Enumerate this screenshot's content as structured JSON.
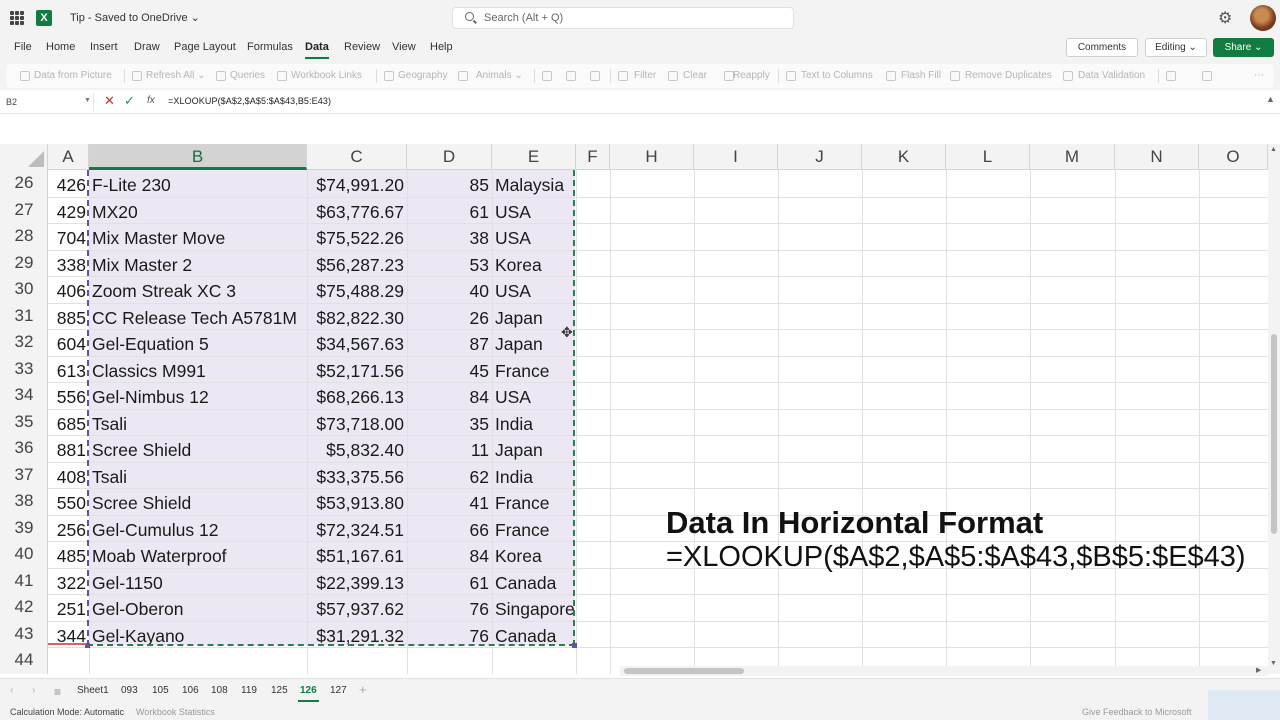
{
  "titlebar": {
    "app_icon": "excel-logo",
    "doc_name": "Tip - Saved to OneDrive ⌄",
    "search_placeholder": "Search (Alt + Q)",
    "settings_icon": "gear-icon"
  },
  "menu": {
    "items": [
      "File",
      "Home",
      "Insert",
      "Draw",
      "Page Layout",
      "Formulas",
      "Data",
      "Review",
      "View",
      "Help"
    ],
    "active": "Data",
    "comments": "Comments",
    "editing": "Editing ⌄",
    "share": "Share ⌄"
  },
  "ribbon": {
    "items": [
      "Data from Picture",
      "Refresh All ⌄",
      "Queries",
      "Workbook Links",
      "Geography",
      "Animals ⌄",
      "Filter",
      "Clear",
      "Reapply",
      "Text to Columns",
      "Flash Fill",
      "Remove Duplicates",
      "Data Validation"
    ]
  },
  "formula_bar": {
    "name_box": "B2",
    "formula": "=XLOOKUP($A$2,$A$5:$A$43,B5:E43)"
  },
  "columns": [
    "A",
    "B",
    "C",
    "D",
    "E",
    "F",
    "H",
    "I",
    "J",
    "K",
    "L",
    "M",
    "N",
    "O"
  ],
  "selected_column": "B",
  "rows": [
    {
      "row": "26",
      "a": "426",
      "b": "F-Lite 230",
      "c": "$74,991.20",
      "d": "85",
      "e": "Malaysia"
    },
    {
      "row": "27",
      "a": "429",
      "b": "MX20",
      "c": "$63,776.67",
      "d": "61",
      "e": "USA"
    },
    {
      "row": "28",
      "a": "704",
      "b": "Mix Master Move",
      "c": "$75,522.26",
      "d": "38",
      "e": "USA"
    },
    {
      "row": "29",
      "a": "338",
      "b": "Mix Master 2",
      "c": "$56,287.23",
      "d": "53",
      "e": "Korea"
    },
    {
      "row": "30",
      "a": "406",
      "b": "Zoom Streak XC 3",
      "c": "$75,488.29",
      "d": "40",
      "e": "USA"
    },
    {
      "row": "31",
      "a": "885",
      "b": "CC Release Tech A5781M",
      "c": "$82,822.30",
      "d": "26",
      "e": "Japan"
    },
    {
      "row": "32",
      "a": "604",
      "b": "Gel-Equation 5",
      "c": "$34,567.63",
      "d": "87",
      "e": "Japan"
    },
    {
      "row": "33",
      "a": "613",
      "b": "Classics M991",
      "c": "$52,171.56",
      "d": "45",
      "e": "France"
    },
    {
      "row": "34",
      "a": "556",
      "b": "Gel-Nimbus 12",
      "c": "$68,266.13",
      "d": "84",
      "e": "USA"
    },
    {
      "row": "35",
      "a": "685",
      "b": "Tsali",
      "c": "$73,718.00",
      "d": "35",
      "e": "India"
    },
    {
      "row": "36",
      "a": "881",
      "b": "Scree Shield",
      "c": "$5,832.40",
      "d": "11",
      "e": "Japan"
    },
    {
      "row": "37",
      "a": "408",
      "b": "Tsali",
      "c": "$33,375.56",
      "d": "62",
      "e": "India"
    },
    {
      "row": "38",
      "a": "550",
      "b": "Scree Shield",
      "c": "$53,913.80",
      "d": "41",
      "e": "France"
    },
    {
      "row": "39",
      "a": "256",
      "b": "Gel-Cumulus 12",
      "c": "$72,324.51",
      "d": "66",
      "e": "France"
    },
    {
      "row": "40",
      "a": "485",
      "b": "Moab Waterproof",
      "c": "$51,167.61",
      "d": "84",
      "e": "Korea"
    },
    {
      "row": "41",
      "a": "322",
      "b": "Gel-1150",
      "c": "$22,399.13",
      "d": "61",
      "e": "Canada"
    },
    {
      "row": "42",
      "a": "251",
      "b": "Gel-Oberon",
      "c": "$57,937.62",
      "d": "76",
      "e": "Singapore"
    },
    {
      "row": "43",
      "a": "344",
      "b": "Gel-Kayano",
      "c": "$31,291.32",
      "d": "76",
      "e": "Canada"
    },
    {
      "row": "44",
      "a": "",
      "b": "",
      "c": "",
      "d": "",
      "e": ""
    }
  ],
  "caption": {
    "title": "Data In Horizontal Format",
    "formula": "=XLOOKUP($A$2,$A$5:$A$43,$B$5:$E$43)"
  },
  "sheets": {
    "tabs": [
      "Sheet1",
      "093",
      "105",
      "106",
      "108",
      "119",
      "125",
      "126",
      "127"
    ],
    "active": "126"
  },
  "status": {
    "calc_mode": "Calculation Mode: Automatic",
    "workbook_stats": "Workbook Statistics",
    "feedback": "Give Feedback to Microsoft"
  },
  "colors": {
    "accent": "#107c41",
    "selection_fill": "#ece8f3"
  }
}
